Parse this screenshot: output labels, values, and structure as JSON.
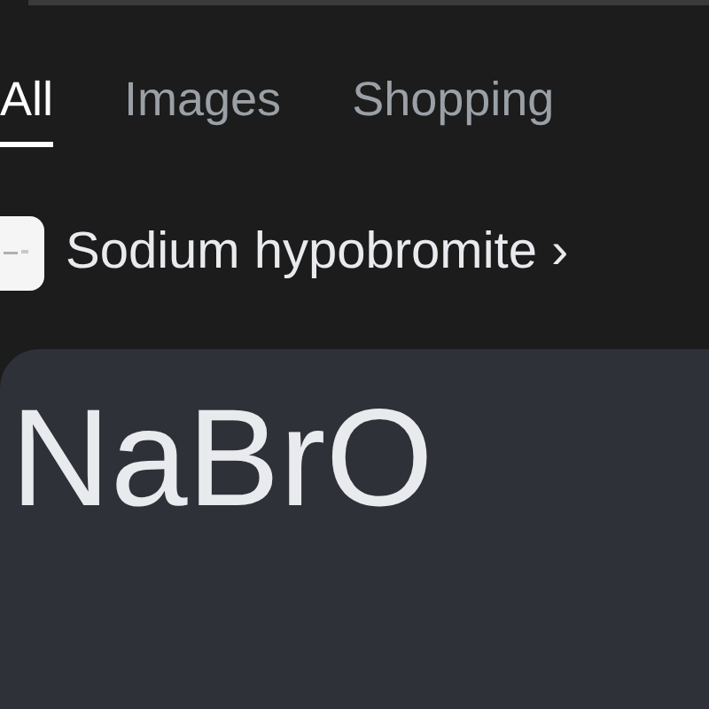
{
  "tabs": [
    {
      "label": "All",
      "selected": true
    },
    {
      "label": "Images",
      "selected": false
    },
    {
      "label": "Shopping",
      "selected": false
    }
  ],
  "entity": {
    "name": "Sodium hypobromite ›"
  },
  "formula": "NaBrO"
}
